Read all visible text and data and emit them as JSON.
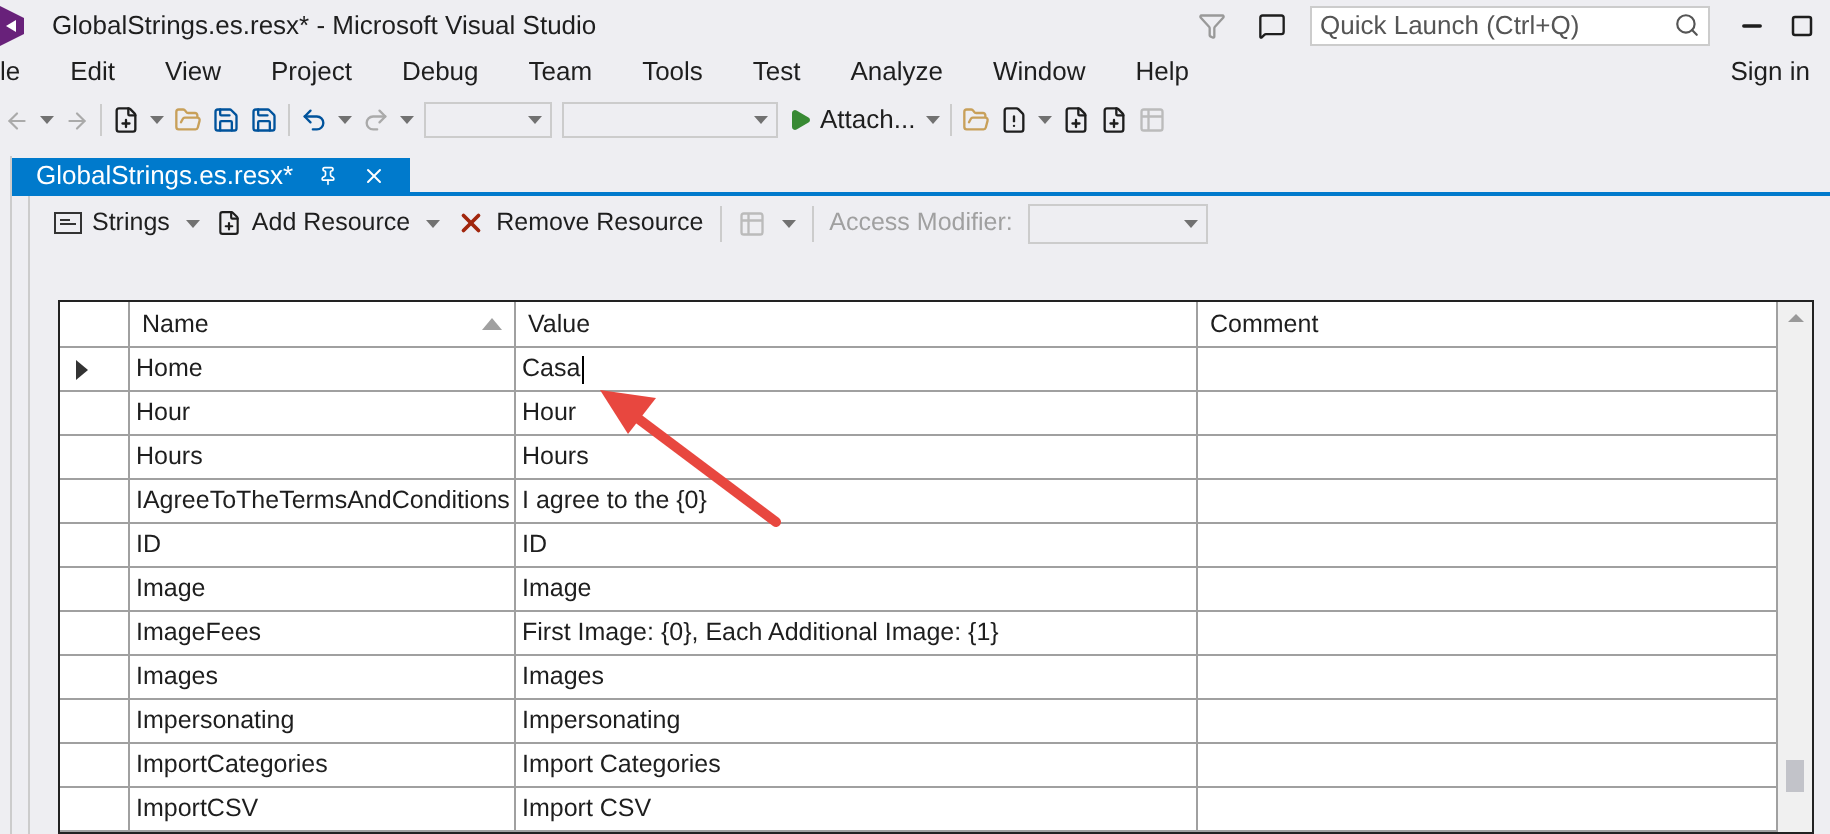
{
  "window": {
    "title": "GlobalStrings.es.resx* - Microsoft Visual Studio"
  },
  "quick_launch": {
    "placeholder": "Quick Launch (Ctrl+Q)"
  },
  "menu": [
    "le",
    "Edit",
    "View",
    "Project",
    "Debug",
    "Team",
    "Tools",
    "Test",
    "Analyze",
    "Window",
    "Help"
  ],
  "sign_in": "Sign in",
  "toolbar": {
    "attach": "Attach..."
  },
  "tabs": [
    {
      "label": "GlobalStrings.es.resx*",
      "selected": true
    }
  ],
  "resource_toolbar": {
    "strings": "Strings",
    "add": "Add Resource",
    "remove": "Remove Resource",
    "access_modifier": "Access Modifier:"
  },
  "table": {
    "columns": [
      "Name",
      "Value",
      "Comment"
    ],
    "rows": [
      {
        "name": "Home",
        "value": "Casa",
        "comment": "",
        "selected": true
      },
      {
        "name": "Hour",
        "value": "Hour",
        "comment": "",
        "selected": false
      },
      {
        "name": "Hours",
        "value": "Hours",
        "comment": "",
        "selected": false
      },
      {
        "name": "IAgreeToTheTermsAndConditions",
        "value": "I agree to the {0}",
        "comment": "",
        "selected": false
      },
      {
        "name": "ID",
        "value": "ID",
        "comment": "",
        "selected": false
      },
      {
        "name": "Image",
        "value": "Image",
        "comment": "",
        "selected": false
      },
      {
        "name": "ImageFees",
        "value": "First Image: {0}, Each Additional Image: {1}",
        "comment": "",
        "selected": false
      },
      {
        "name": "Images",
        "value": "Images",
        "comment": "",
        "selected": false
      },
      {
        "name": "Impersonating",
        "value": "Impersonating",
        "comment": "",
        "selected": false
      },
      {
        "name": "ImportCategories",
        "value": "Import Categories",
        "comment": "",
        "selected": false
      },
      {
        "name": "ImportCSV",
        "value": "Import CSV",
        "comment": "",
        "selected": false
      }
    ]
  }
}
